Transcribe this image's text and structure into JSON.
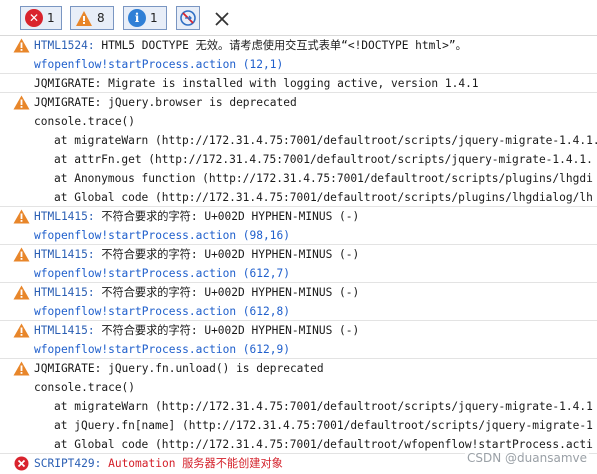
{
  "toolbar": {
    "errors_count": "1",
    "warnings_count": "8",
    "info_count": "1"
  },
  "rows": [
    {
      "code": "HTML1524:",
      "message": " HTML5 DOCTYPE 无效。请考虑使用交互式表单“<!DOCTYPE html>”。"
    },
    {
      "link": "wfopenflow!startProcess.action (12,1)"
    },
    {
      "message": "JQMIGRATE: Migrate is installed with logging active, version 1.4.1"
    },
    {
      "message": "JQMIGRATE: jQuery.browser is deprecated"
    },
    {
      "message": "console.trace()"
    },
    {
      "message": "at migrateWarn (http://172.31.4.75:7001/defaultroot/scripts/jquery-migrate-1.4.1."
    },
    {
      "message": "at attrFn.get (http://172.31.4.75:7001/defaultroot/scripts/jquery-migrate-1.4.1."
    },
    {
      "message": "at Anonymous function (http://172.31.4.75:7001/defaultroot/scripts/plugins/lhgdi"
    },
    {
      "message": "at Global code (http://172.31.4.75:7001/defaultroot/scripts/plugins/lhgdialog/lh"
    },
    {
      "code": "HTML1415:",
      "message": " 不符合要求的字符: U+002D HYPHEN-MINUS (-)"
    },
    {
      "link": "wfopenflow!startProcess.action (98,16)"
    },
    {
      "code": "HTML1415:",
      "message": " 不符合要求的字符: U+002D HYPHEN-MINUS (-)"
    },
    {
      "link": "wfopenflow!startProcess.action (612,7)"
    },
    {
      "code": "HTML1415:",
      "message": " 不符合要求的字符: U+002D HYPHEN-MINUS (-)"
    },
    {
      "link": "wfopenflow!startProcess.action (612,8)"
    },
    {
      "code": "HTML1415:",
      "message": " 不符合要求的字符: U+002D HYPHEN-MINUS (-)"
    },
    {
      "link": "wfopenflow!startProcess.action (612,9)"
    },
    {
      "message": "JQMIGRATE: jQuery.fn.unload() is deprecated"
    },
    {
      "message": "console.trace()"
    },
    {
      "message": "at migrateWarn (http://172.31.4.75:7001/defaultroot/scripts/jquery-migrate-1.4.1"
    },
    {
      "message": "at jQuery.fn[name] (http://172.31.4.75:7001/defaultroot/scripts/jquery-migrate-1"
    },
    {
      "message": "at Global code (http://172.31.4.75:7001/defaultroot/wfopenflow!startProcess.acti"
    },
    {
      "code": "SCRIPT429:",
      "message": " Automation 服务器不能创建对象"
    }
  ],
  "watermark": "CSDN @duansamve",
  "colors": {
    "error": "#d9232d",
    "warning": "#e8862a",
    "info": "#2f7fd6",
    "link": "#1f5fcc"
  },
  "icons": {
    "error": "error-x-circle-icon",
    "warning": "warning-triangle-icon",
    "info": "info-circle-icon",
    "clear": "clear-console-icon",
    "close": "close-icon"
  }
}
